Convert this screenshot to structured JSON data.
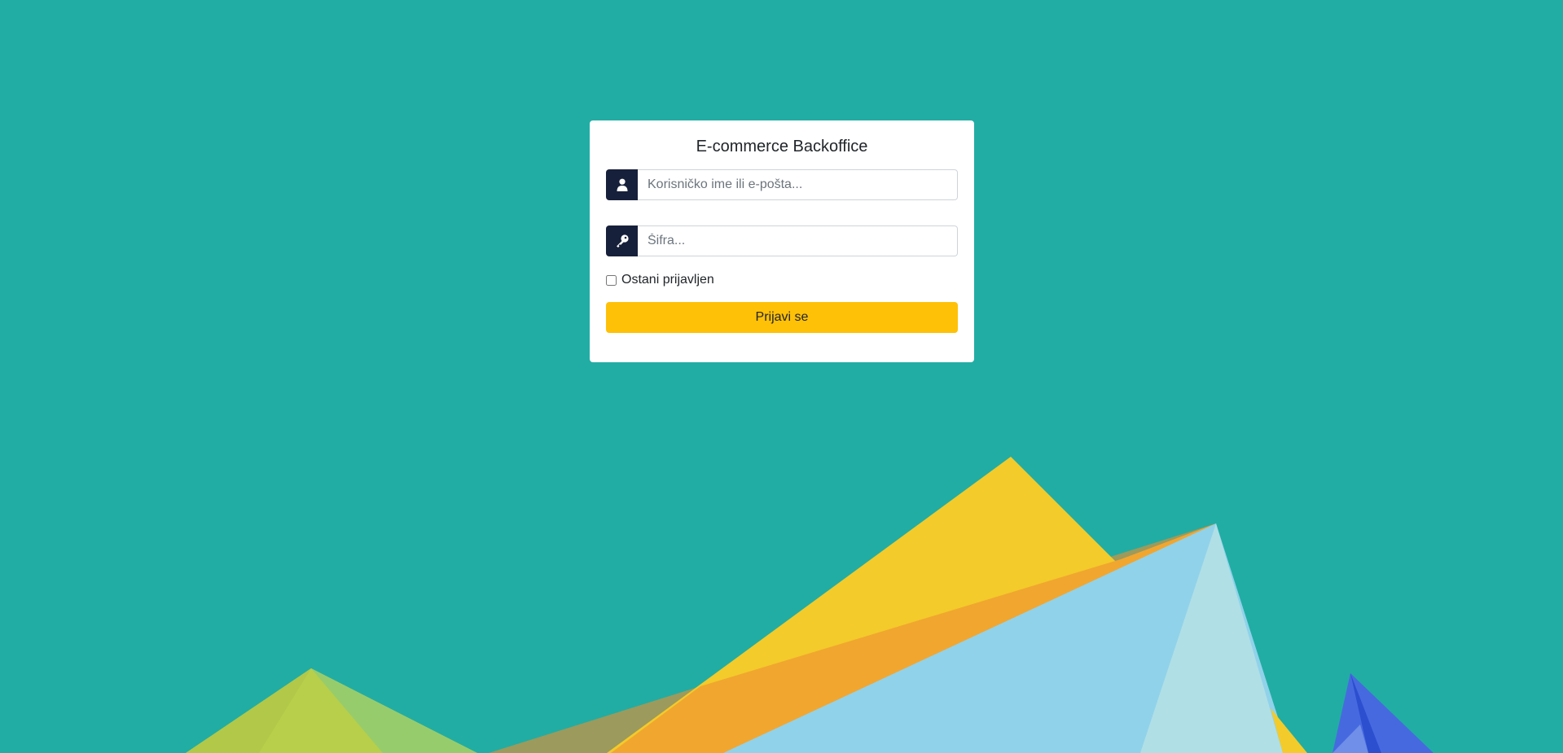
{
  "login": {
    "title": "E-commerce Backoffice",
    "username": {
      "placeholder": "Korisničko ime ili e-pošta...",
      "value": "",
      "icon": "user-icon"
    },
    "password": {
      "placeholder": "Šifra...",
      "value": "",
      "icon": "key-icon"
    },
    "remember_label": "Ostani prijavljen",
    "remember_checked": false,
    "submit_label": "Prijavi se"
  },
  "colors": {
    "background": "#21ada4",
    "card": "#ffffff",
    "addon": "#17203a",
    "button": "#ffc107"
  }
}
